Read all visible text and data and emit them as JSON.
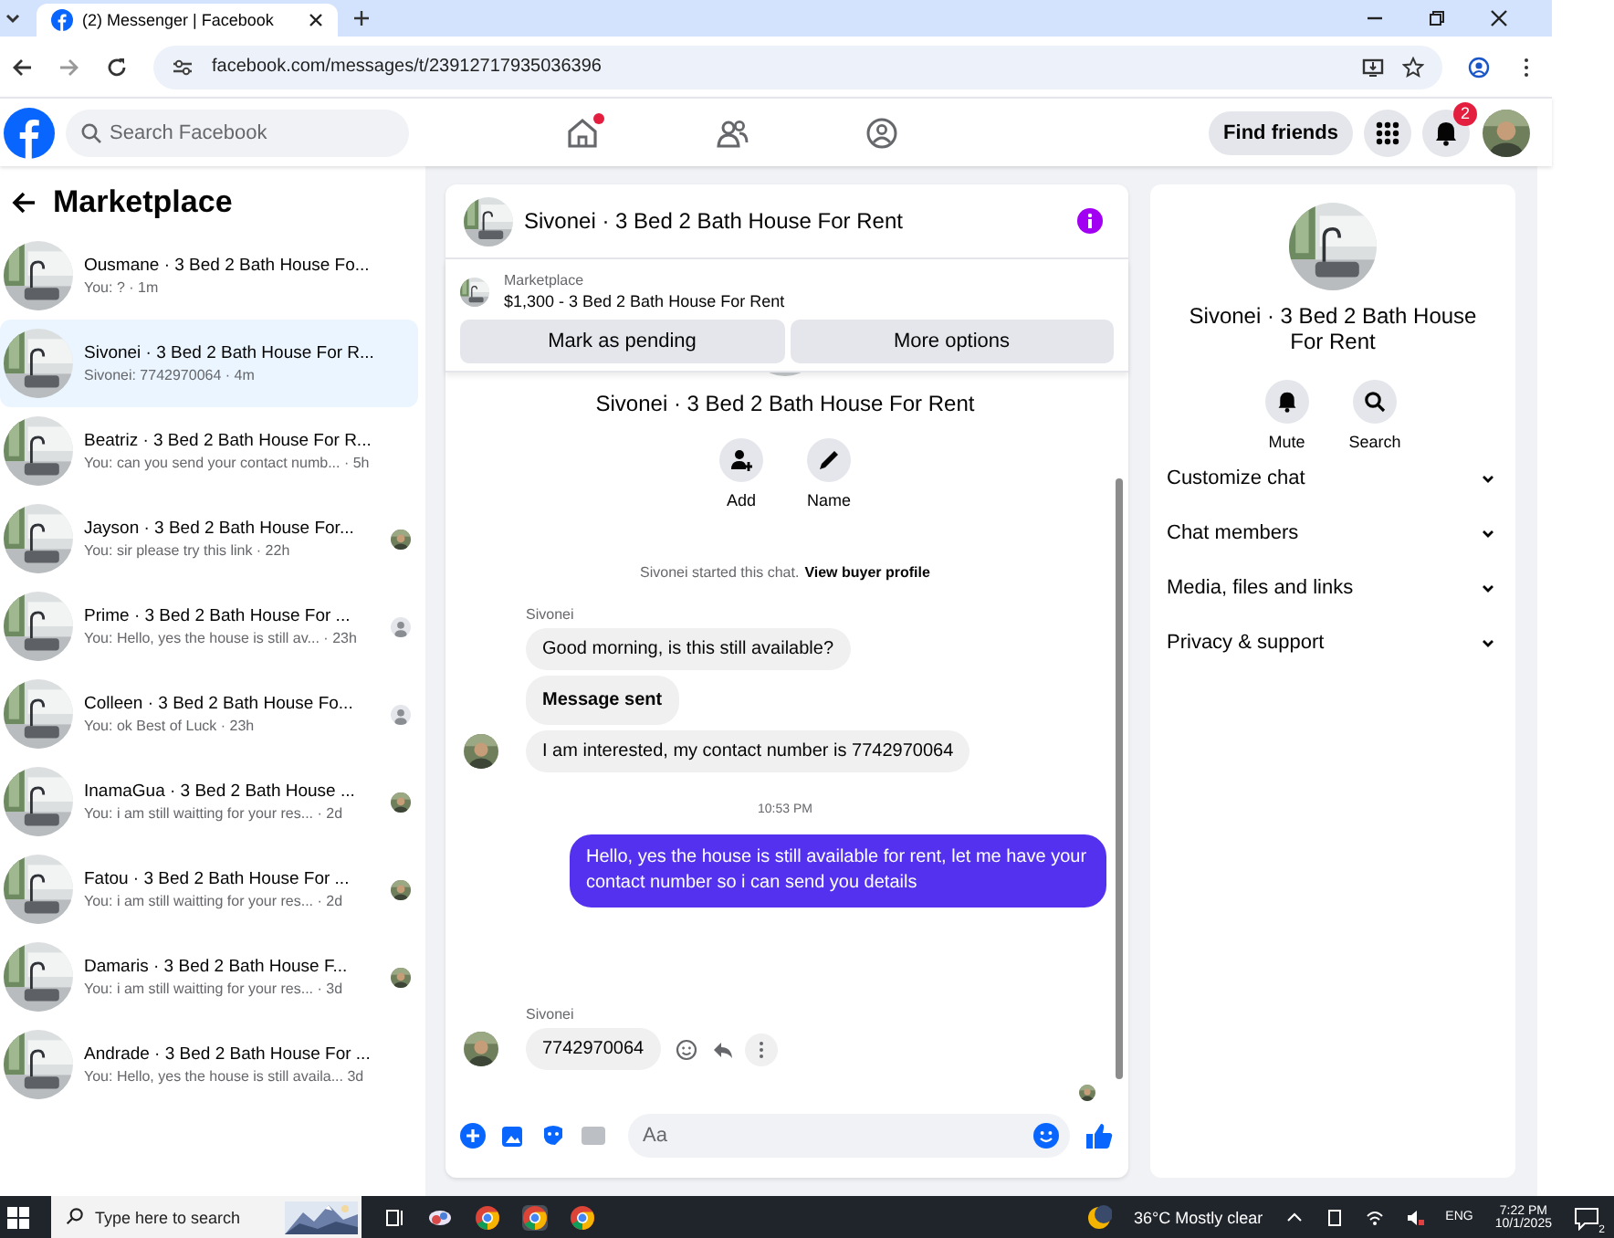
{
  "browser": {
    "tab_title": "(2) Messenger | Facebook",
    "url": "facebook.com/messages/t/23912717935036396"
  },
  "header": {
    "search_placeholder": "Search Facebook",
    "find_friends": "Find friends",
    "notification_count": "2",
    "home_has_update": true
  },
  "sidebar": {
    "title": "Marketplace",
    "conversations": [
      {
        "kind": "plain",
        "name": "Ousmane · 3 Bed 2 Bath House Fo...",
        "preview": "You: ? · 1m",
        "selected": false
      },
      {
        "kind": "plain",
        "name": "Sivonei · 3 Bed 2 Bath House For R...",
        "preview": "Sivonei: 7742970064 · 4m",
        "selected": true
      },
      {
        "kind": "plain",
        "name": "Beatriz · 3 Bed 2 Bath House For R...",
        "preview": "You: can you send your contact numb... · 5h",
        "selected": false
      },
      {
        "kind": "seen_photo",
        "name": "Jayson · 3 Bed 2 Bath House For...",
        "preview": "You: sir please try this link · 22h",
        "selected": false
      },
      {
        "kind": "seen_silhouette",
        "name": "Prime · 3 Bed 2 Bath House For ...",
        "preview": "You: Hello, yes the house is still av... · 23h",
        "selected": false
      },
      {
        "kind": "seen_silhouette",
        "name": "Colleen · 3 Bed 2 Bath House Fo...",
        "preview": "You: ok Best of Luck · 23h",
        "selected": false
      },
      {
        "kind": "seen_photo",
        "name": "InamaGua · 3 Bed 2 Bath House ...",
        "preview": "You: i am still waitting for your res... · 2d",
        "selected": false
      },
      {
        "kind": "seen_photo",
        "name": "Fatou · 3 Bed 2 Bath House For ...",
        "preview": "You: i am still waitting for your res... · 2d",
        "selected": false
      },
      {
        "kind": "seen_photo",
        "name": "Damaris · 3 Bed 2 Bath House F...",
        "preview": "You: i am still waitting for your res... · 3d",
        "selected": false
      },
      {
        "kind": "plain",
        "name": "Andrade · 3 Bed 2 Bath House For ...",
        "preview": "You: Hello, yes the house is still availa... 3d",
        "selected": false
      }
    ]
  },
  "chat": {
    "title": "Sivonei · 3 Bed 2 Bath House For Rent",
    "listing_label": "Marketplace",
    "listing": "$1,300 - 3 Bed 2 Bath House For Rent",
    "buttons": [
      "Mark as pending",
      "More options"
    ],
    "intro_title": "Sivonei · 3 Bed 2 Bath House For Rent",
    "intro_actions": [
      {
        "label": "Add",
        "kind": "add"
      },
      {
        "label": "Name",
        "kind": "name"
      }
    ],
    "messages": [
      {
        "kind": "system",
        "text": "Sivonei started this chat.",
        "link": "View buyer profile"
      },
      {
        "kind": "sender",
        "text": "Sivonei"
      },
      {
        "kind": "incoming",
        "text": "Good morning, is this still available?",
        "avatar": false
      },
      {
        "kind": "notice",
        "text": "Message sent"
      },
      {
        "kind": "incoming",
        "text": "I am interested, my contact number is 7742970064",
        "avatar": true
      },
      {
        "kind": "time",
        "text": "10:53 PM"
      },
      {
        "kind": "outgoing",
        "text": "Hello, yes the house is still available for rent, let me have your contact number so i can send you details"
      },
      {
        "kind": "sender",
        "text": "Sivonei"
      },
      {
        "kind": "incoming",
        "text": "7742970064",
        "avatar": true,
        "actions": true
      }
    ],
    "composer_placeholder": "Aa"
  },
  "details": {
    "title": "Sivonei · 3 Bed 2 Bath House For Rent",
    "actions": [
      {
        "label": "Mute",
        "kind": "mute"
      },
      {
        "label": "Search",
        "kind": "search"
      }
    ],
    "sections": [
      {
        "label": "Customize chat",
        "expanded": false
      },
      {
        "label": "Chat members",
        "expanded": false
      },
      {
        "label": "Media, files and links",
        "expanded": false
      },
      {
        "label": "Privacy & support",
        "expanded": false
      }
    ]
  },
  "taskbar": {
    "search_placeholder": "Type here to search",
    "weather": "36°C Mostly clear",
    "language": "ENG",
    "time": "7:22 PM",
    "date": "10/1/2025",
    "notification_count": "2"
  }
}
